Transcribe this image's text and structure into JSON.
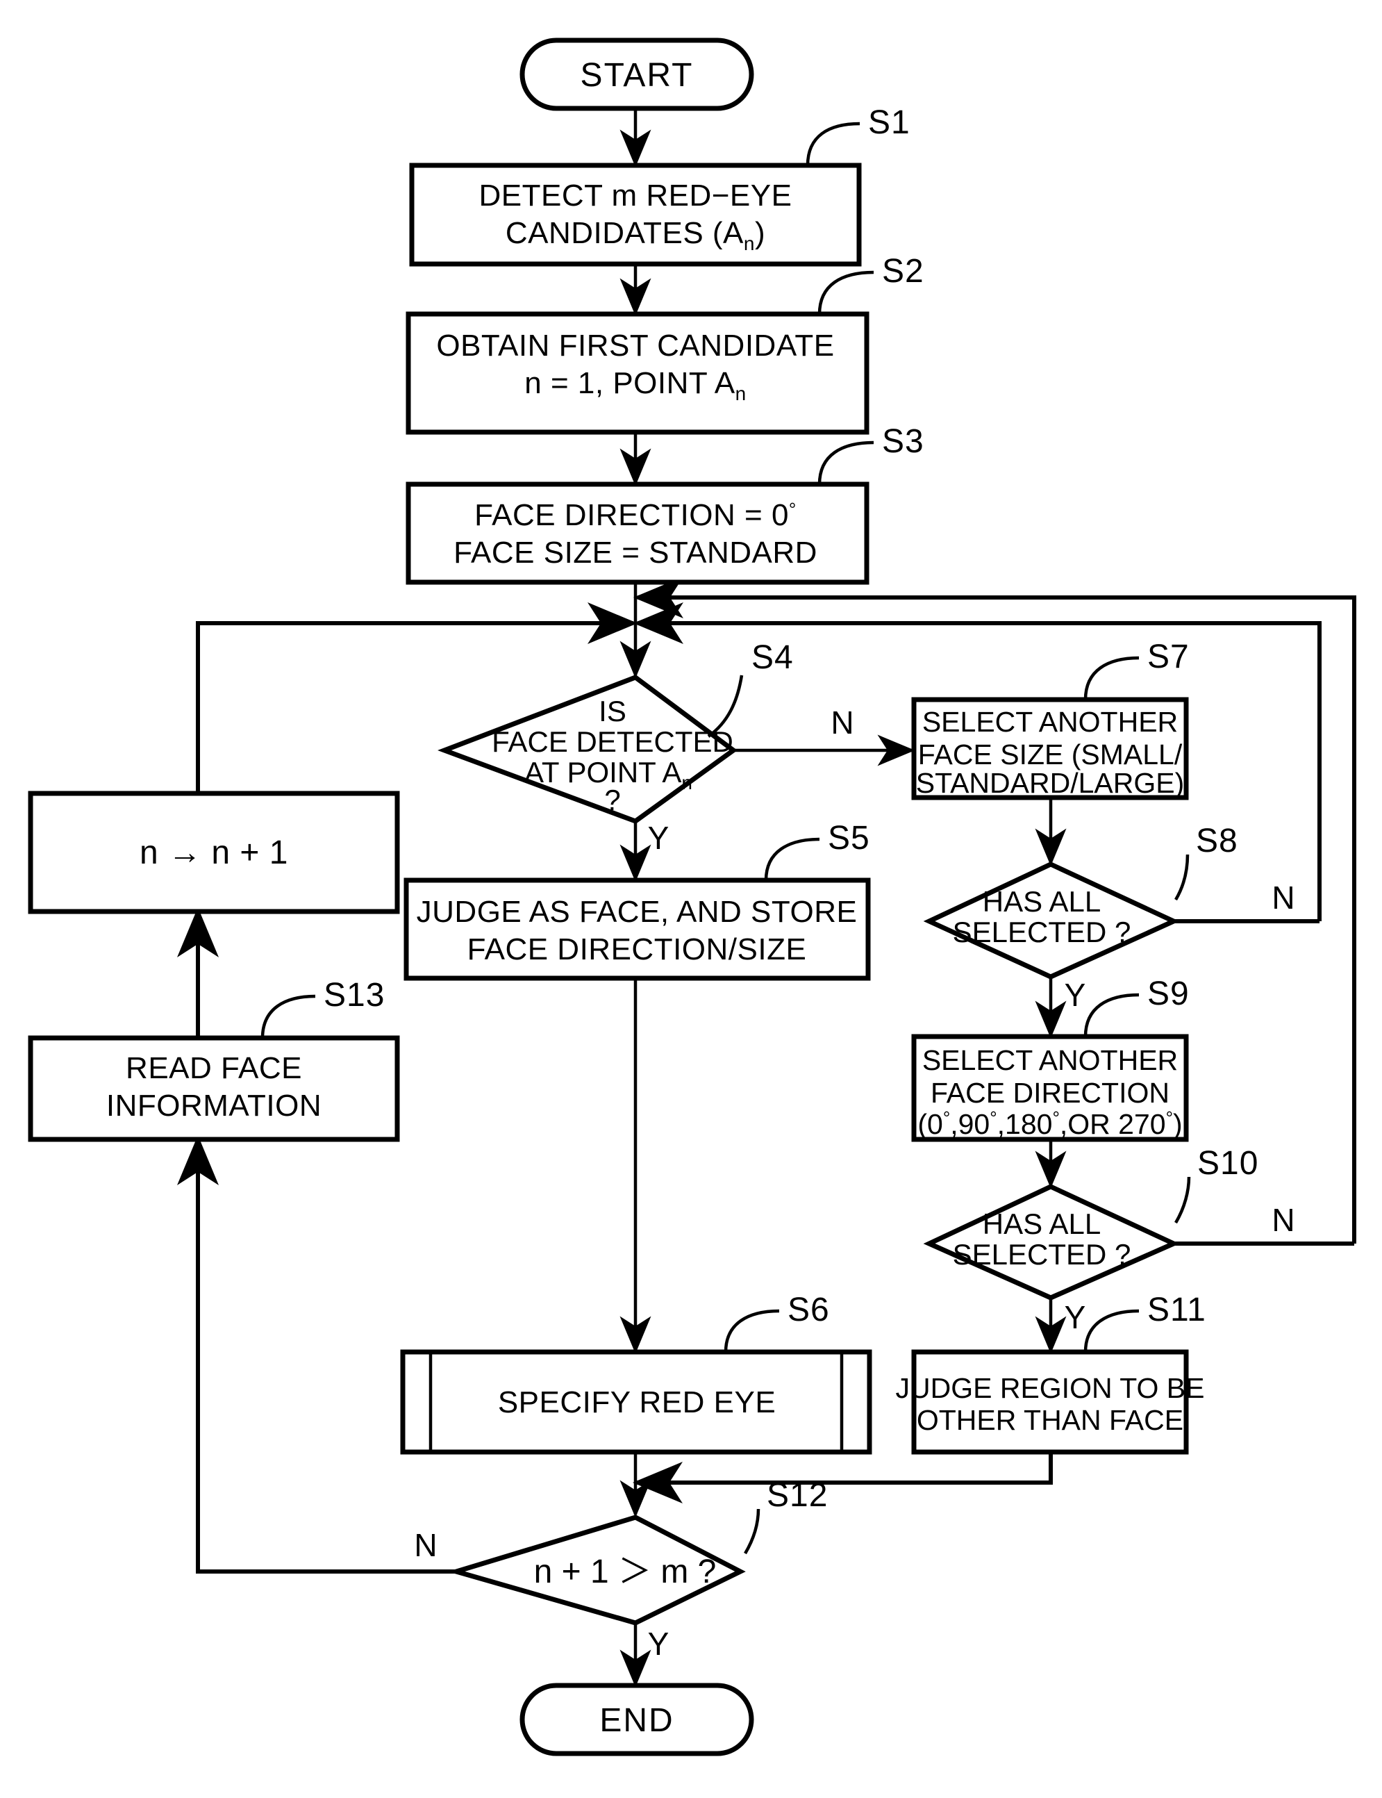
{
  "diagram": {
    "type": "flowchart",
    "title": "Red-eye detection / face judgement flowchart",
    "terminators": {
      "start": "START",
      "end": "END"
    },
    "nodes": [
      {
        "id": "S1",
        "step_label": "S1",
        "shape": "process",
        "lines": [
          "DETECT m RED−EYE",
          "CANDIDATES (Aₙ)"
        ],
        "line1": "DETECT m RED−EYE",
        "line2_pre": "CANDIDATES (A",
        "line2_sub": "n",
        "line2_post": ")"
      },
      {
        "id": "S2",
        "step_label": "S2",
        "shape": "process",
        "line1": "OBTAIN FIRST CANDIDATE",
        "line2_pre": "n = 1, POINT A",
        "line2_sub": "n",
        "line2_post": ""
      },
      {
        "id": "S3",
        "step_label": "S3",
        "shape": "process",
        "line1_pre": "FACE DIRECTION = 0",
        "line1_deg": "°",
        "line2": "FACE SIZE = STANDARD"
      },
      {
        "id": "S4",
        "step_label": "S4",
        "shape": "decision",
        "line1": "IS",
        "line2": "FACE DETECTED",
        "line3_pre": "AT POINT A",
        "line3_sub": "n",
        "line4": "?",
        "branch_yes": "Y",
        "branch_no": "N"
      },
      {
        "id": "S5",
        "step_label": "S5",
        "shape": "process",
        "line1": "JUDGE AS FACE, AND STORE",
        "line2": "FACE DIRECTION/SIZE"
      },
      {
        "id": "S6",
        "step_label": "S6",
        "shape": "predefined-process",
        "line1": "SPECIFY RED EYE"
      },
      {
        "id": "S7",
        "step_label": "S7",
        "shape": "process",
        "line1": "SELECT ANOTHER",
        "line2": "FACE SIZE (SMALL/",
        "line3": "STANDARD/LARGE)"
      },
      {
        "id": "S8",
        "step_label": "S8",
        "shape": "decision",
        "line1": "HAS ALL",
        "line2": "SELECTED ?",
        "branch_yes": "Y",
        "branch_no": "N"
      },
      {
        "id": "S9",
        "step_label": "S9",
        "shape": "process",
        "line1": "SELECT ANOTHER",
        "line2": "FACE DIRECTION",
        "line3_parts": [
          "(0",
          "°",
          ",90",
          "°",
          ",180",
          "°",
          ",OR 270",
          "°",
          ")"
        ],
        "line3_plain": "(0°,90°,180°,OR 270°)"
      },
      {
        "id": "S10",
        "step_label": "S10",
        "shape": "decision",
        "line1": "HAS ALL",
        "line2": "SELECTED ?",
        "branch_yes": "Y",
        "branch_no": "N"
      },
      {
        "id": "S11",
        "step_label": "S11",
        "shape": "process",
        "line1": "JUDGE REGION TO BE",
        "line2": "OTHER THAN FACE"
      },
      {
        "id": "S12",
        "step_label": "S12",
        "shape": "decision",
        "line1": "n + 1 ＞ m ?",
        "branch_yes": "Y",
        "branch_no": "N"
      },
      {
        "id": "S13",
        "step_label": "S13",
        "shape": "process",
        "line1": "READ FACE",
        "line2": "INFORMATION"
      },
      {
        "id": "INC",
        "step_label": "",
        "shape": "process",
        "line1": "n → n + 1"
      }
    ],
    "edge_labels": {
      "s4_no": "N",
      "s4_yes": "Y",
      "s8_no": "N",
      "s8_yes": "Y",
      "s10_no": "N",
      "s10_yes": "Y",
      "s12_no": "N",
      "s12_yes": "Y"
    },
    "colors": {
      "line": "#000000",
      "fill": "#ffffff",
      "background": "#ffffff"
    }
  }
}
